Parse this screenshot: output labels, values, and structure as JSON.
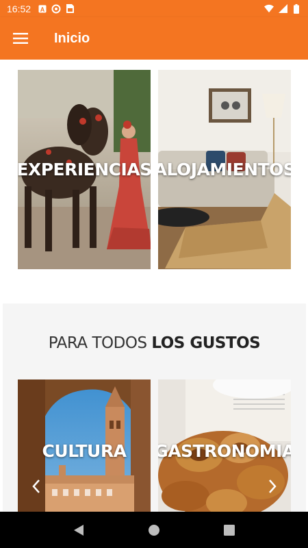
{
  "status_bar": {
    "time": "16:52",
    "left_icons": [
      "a-icon",
      "sync-icon",
      "sim-icon"
    ],
    "right_icons": [
      "wifi-icon",
      "signal-icon",
      "battery-icon"
    ]
  },
  "app_bar": {
    "title": "Inicio",
    "menu_icon": "hamburger-icon",
    "color": "#f47521"
  },
  "tiles": [
    {
      "label": "EXPERIENCIAS"
    },
    {
      "label": "ALOJAMIENTOS"
    }
  ],
  "section": {
    "title_light": "PARA TODOS ",
    "title_bold": "LOS GUSTOS",
    "carousel": [
      {
        "label": "CULTURA"
      },
      {
        "label": "GASTRONOMIA"
      }
    ]
  },
  "nav_bar": {
    "buttons": [
      "back-icon",
      "home-icon",
      "recents-icon"
    ]
  }
}
